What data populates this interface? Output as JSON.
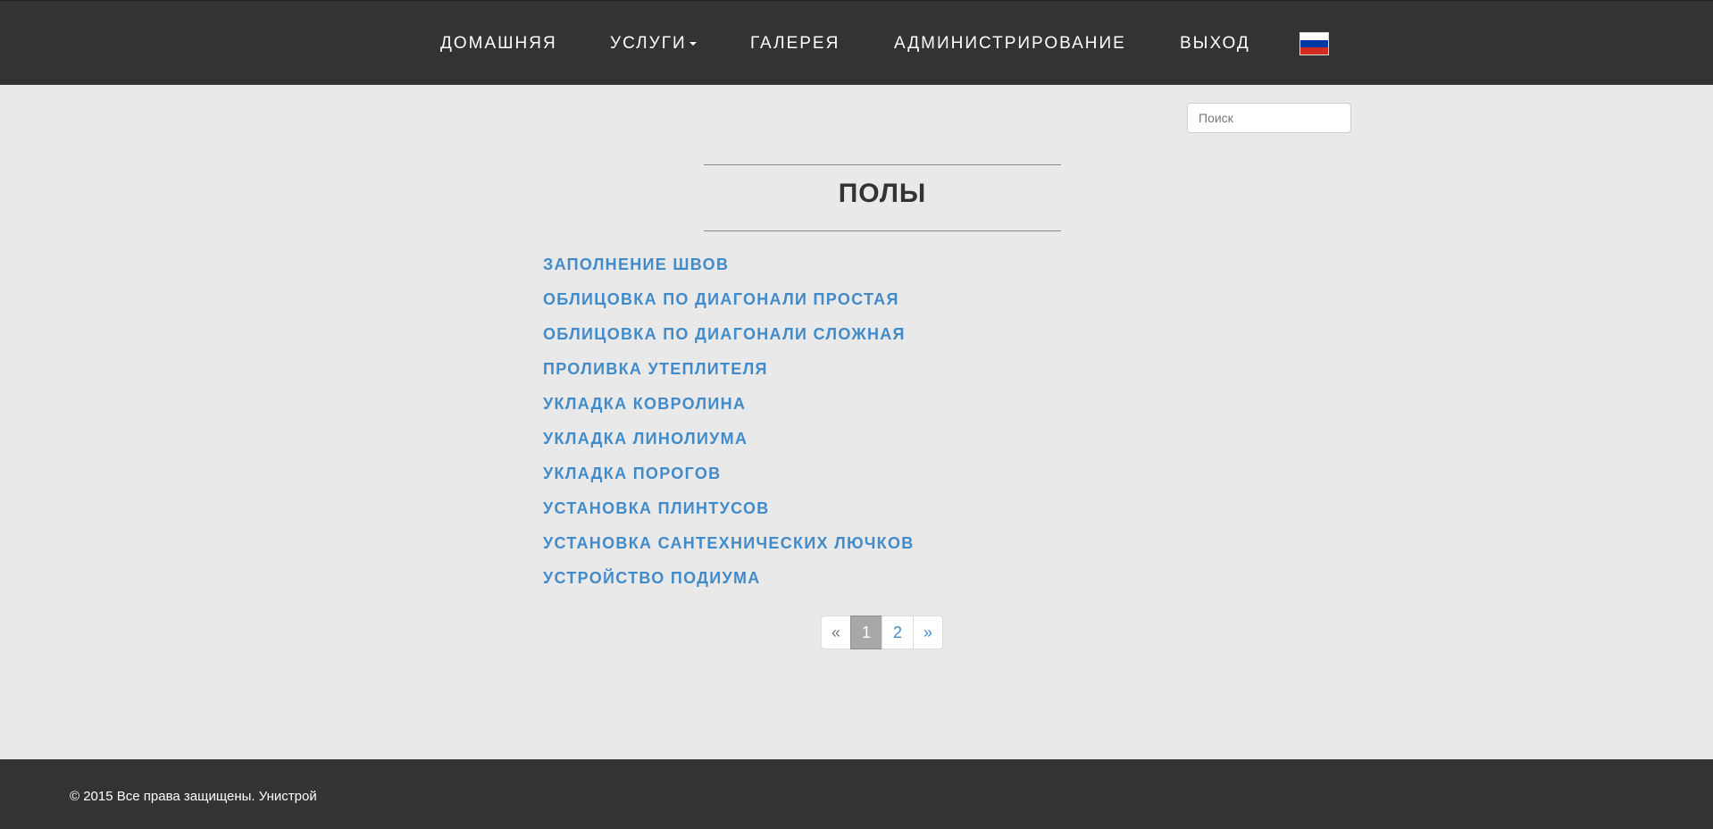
{
  "nav": {
    "home": "ДОМАШНЯЯ",
    "services": "УСЛУГИ",
    "gallery": "ГАЛЕРЕЯ",
    "admin": "АДМИНИСТРИРОВАНИЕ",
    "logout": "ВЫХОД",
    "flag_icon": "russian-flag-icon",
    "flag_colors": [
      "#ffffff",
      "#0039a6",
      "#d52b1e"
    ]
  },
  "search": {
    "placeholder": "Поиск",
    "value": ""
  },
  "page": {
    "title": "ПОЛЫ"
  },
  "links": [
    "ЗАПОЛНЕНИЕ ШВОВ",
    "ОБЛИЦОВКА ПО ДИАГОНАЛИ ПРОСТАЯ",
    "ОБЛИЦОВКА ПО ДИАГОНАЛИ СЛОЖНАЯ",
    "ПРОЛИВКА УТЕПЛИТЕЛЯ",
    "УКЛАДКА КОВРОЛИНА",
    "УКЛАДКА ЛИНОЛИУМА",
    "УКЛАДКА ПОРОГОВ",
    "УСТАНОВКА ПЛИНТУСОВ",
    "УСТАНОВКА САНТЕХНИЧЕСКИХ ЛЮЧКОВ",
    "УСТРОЙСТВО ПОДИУМА"
  ],
  "pagination": {
    "prev": "«",
    "pages": [
      "1",
      "2"
    ],
    "active": "1",
    "next": "»"
  },
  "footer": {
    "text": "© 2015 Все права защищены. Унистрой"
  },
  "colors": {
    "header_bg": "#333333",
    "body_bg": "#e9e9e9",
    "link": "#428bca"
  }
}
